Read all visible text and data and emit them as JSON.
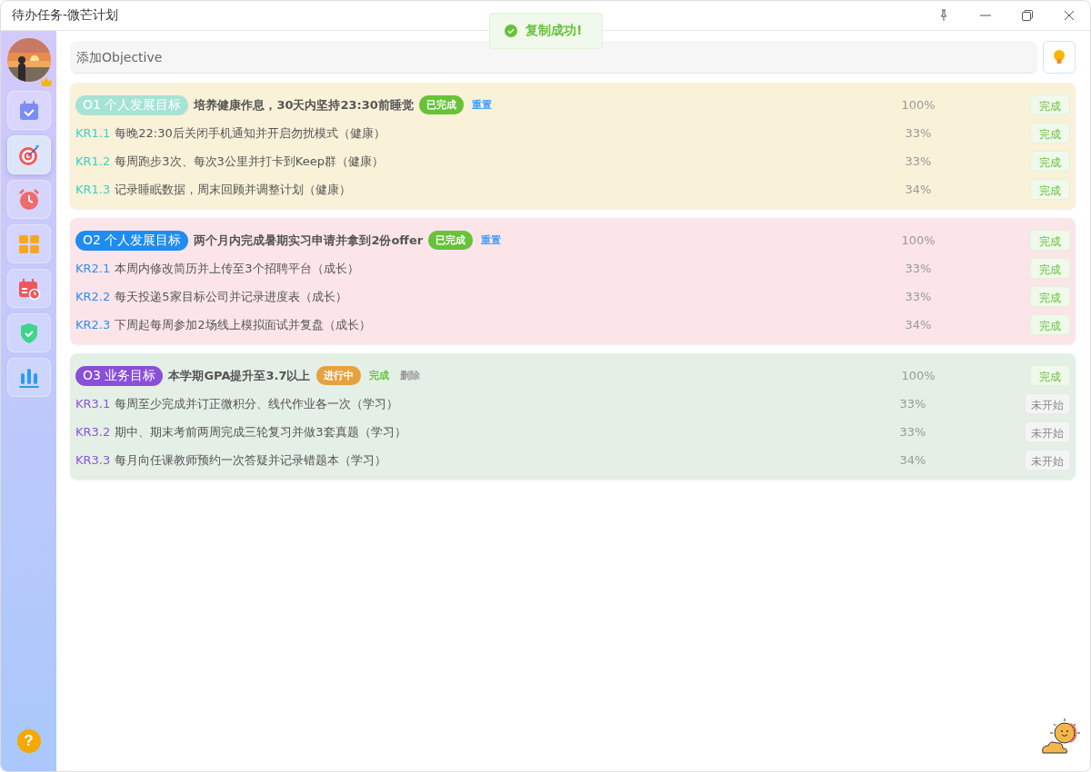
{
  "window": {
    "title": "待办任务-微芒计划"
  },
  "toast": {
    "text": "复制成功!"
  },
  "sidebar": {
    "items": [
      {
        "kind": "calendar",
        "selected": false
      },
      {
        "kind": "target",
        "selected": true
      },
      {
        "kind": "alarm",
        "selected": false
      },
      {
        "kind": "grid",
        "selected": false
      },
      {
        "kind": "schedule",
        "selected": false
      },
      {
        "kind": "shield",
        "selected": false
      },
      {
        "kind": "chart",
        "selected": false
      }
    ],
    "help": {
      "label": "?"
    }
  },
  "add_field": {
    "placeholder": "添加Objective"
  },
  "objectives": [
    {
      "kind": "wellness",
      "tag": "O1 个人发展目标",
      "title": "培养健康作息，30天内坚持23:30前睡觉",
      "status": "已完成",
      "done": true,
      "actions": [
        {
          "label": "重置",
          "kind": "link"
        }
      ],
      "progress": "100%",
      "button": {
        "label": "完成",
        "kind": "done"
      },
      "key_results": [
        {
          "code": "KR1.1",
          "text": "每晚22:30后关闭手机通知并开启勿扰模式（健康）",
          "progress": "33%",
          "button": {
            "label": "完成",
            "kind": "done"
          }
        },
        {
          "code": "KR1.2",
          "text": "每周跑步3次、每次3公里并打卡到Keep群（健康）",
          "progress": "33%",
          "button": {
            "label": "完成",
            "kind": "done"
          }
        },
        {
          "code": "KR1.3",
          "text": "记录睡眠数据，周末回顾并调整计划（健康）",
          "progress": "34%",
          "button": {
            "label": "完成",
            "kind": "done"
          }
        }
      ]
    },
    {
      "kind": "career",
      "tag": "O2 个人发展目标",
      "title": "两个月内完成暑期实习申请并拿到2份offer",
      "status": "已完成",
      "done": true,
      "actions": [
        {
          "label": "重置",
          "kind": "link"
        }
      ],
      "progress": "100%",
      "button": {
        "label": "完成",
        "kind": "done"
      },
      "key_results": [
        {
          "code": "KR2.1",
          "text": "本周内修改简历并上传至3个招聘平台（成长）",
          "progress": "33%",
          "button": {
            "label": "完成",
            "kind": "done"
          }
        },
        {
          "code": "KR2.2",
          "text": "每天投递5家目标公司并记录进度表（成长）",
          "progress": "33%",
          "button": {
            "label": "完成",
            "kind": "done"
          }
        },
        {
          "code": "KR2.3",
          "text": "下周起每周参加2场线上模拟面试并复盘（成长）",
          "progress": "34%",
          "button": {
            "label": "完成",
            "kind": "done"
          }
        }
      ]
    },
    {
      "kind": "study",
      "tag": "O3 业务目标",
      "title": "本学期GPA提升至3.7以上",
      "status": "进行中",
      "done": false,
      "actions": [
        {
          "label": "完成",
          "kind": "complete"
        },
        {
          "label": "删除",
          "kind": "delete"
        }
      ],
      "progress": "100%",
      "button": {
        "label": "完成",
        "kind": "done"
      },
      "key_results": [
        {
          "code": "KR3.1",
          "text": "每周至少完成并订正微积分、线代作业各一次（学习）",
          "progress": "33%",
          "button": {
            "label": "未开始",
            "kind": "todo"
          }
        },
        {
          "code": "KR3.2",
          "text": "期中、期末考前两周完成三轮复习并做3套真题（学习）",
          "progress": "33%",
          "button": {
            "label": "未开始",
            "kind": "todo"
          }
        },
        {
          "code": "KR3.3",
          "text": "每月向任课教师预约一次答疑并记录错题本（学习）",
          "progress": "34%",
          "button": {
            "label": "未开始",
            "kind": "todo"
          }
        }
      ]
    }
  ]
}
